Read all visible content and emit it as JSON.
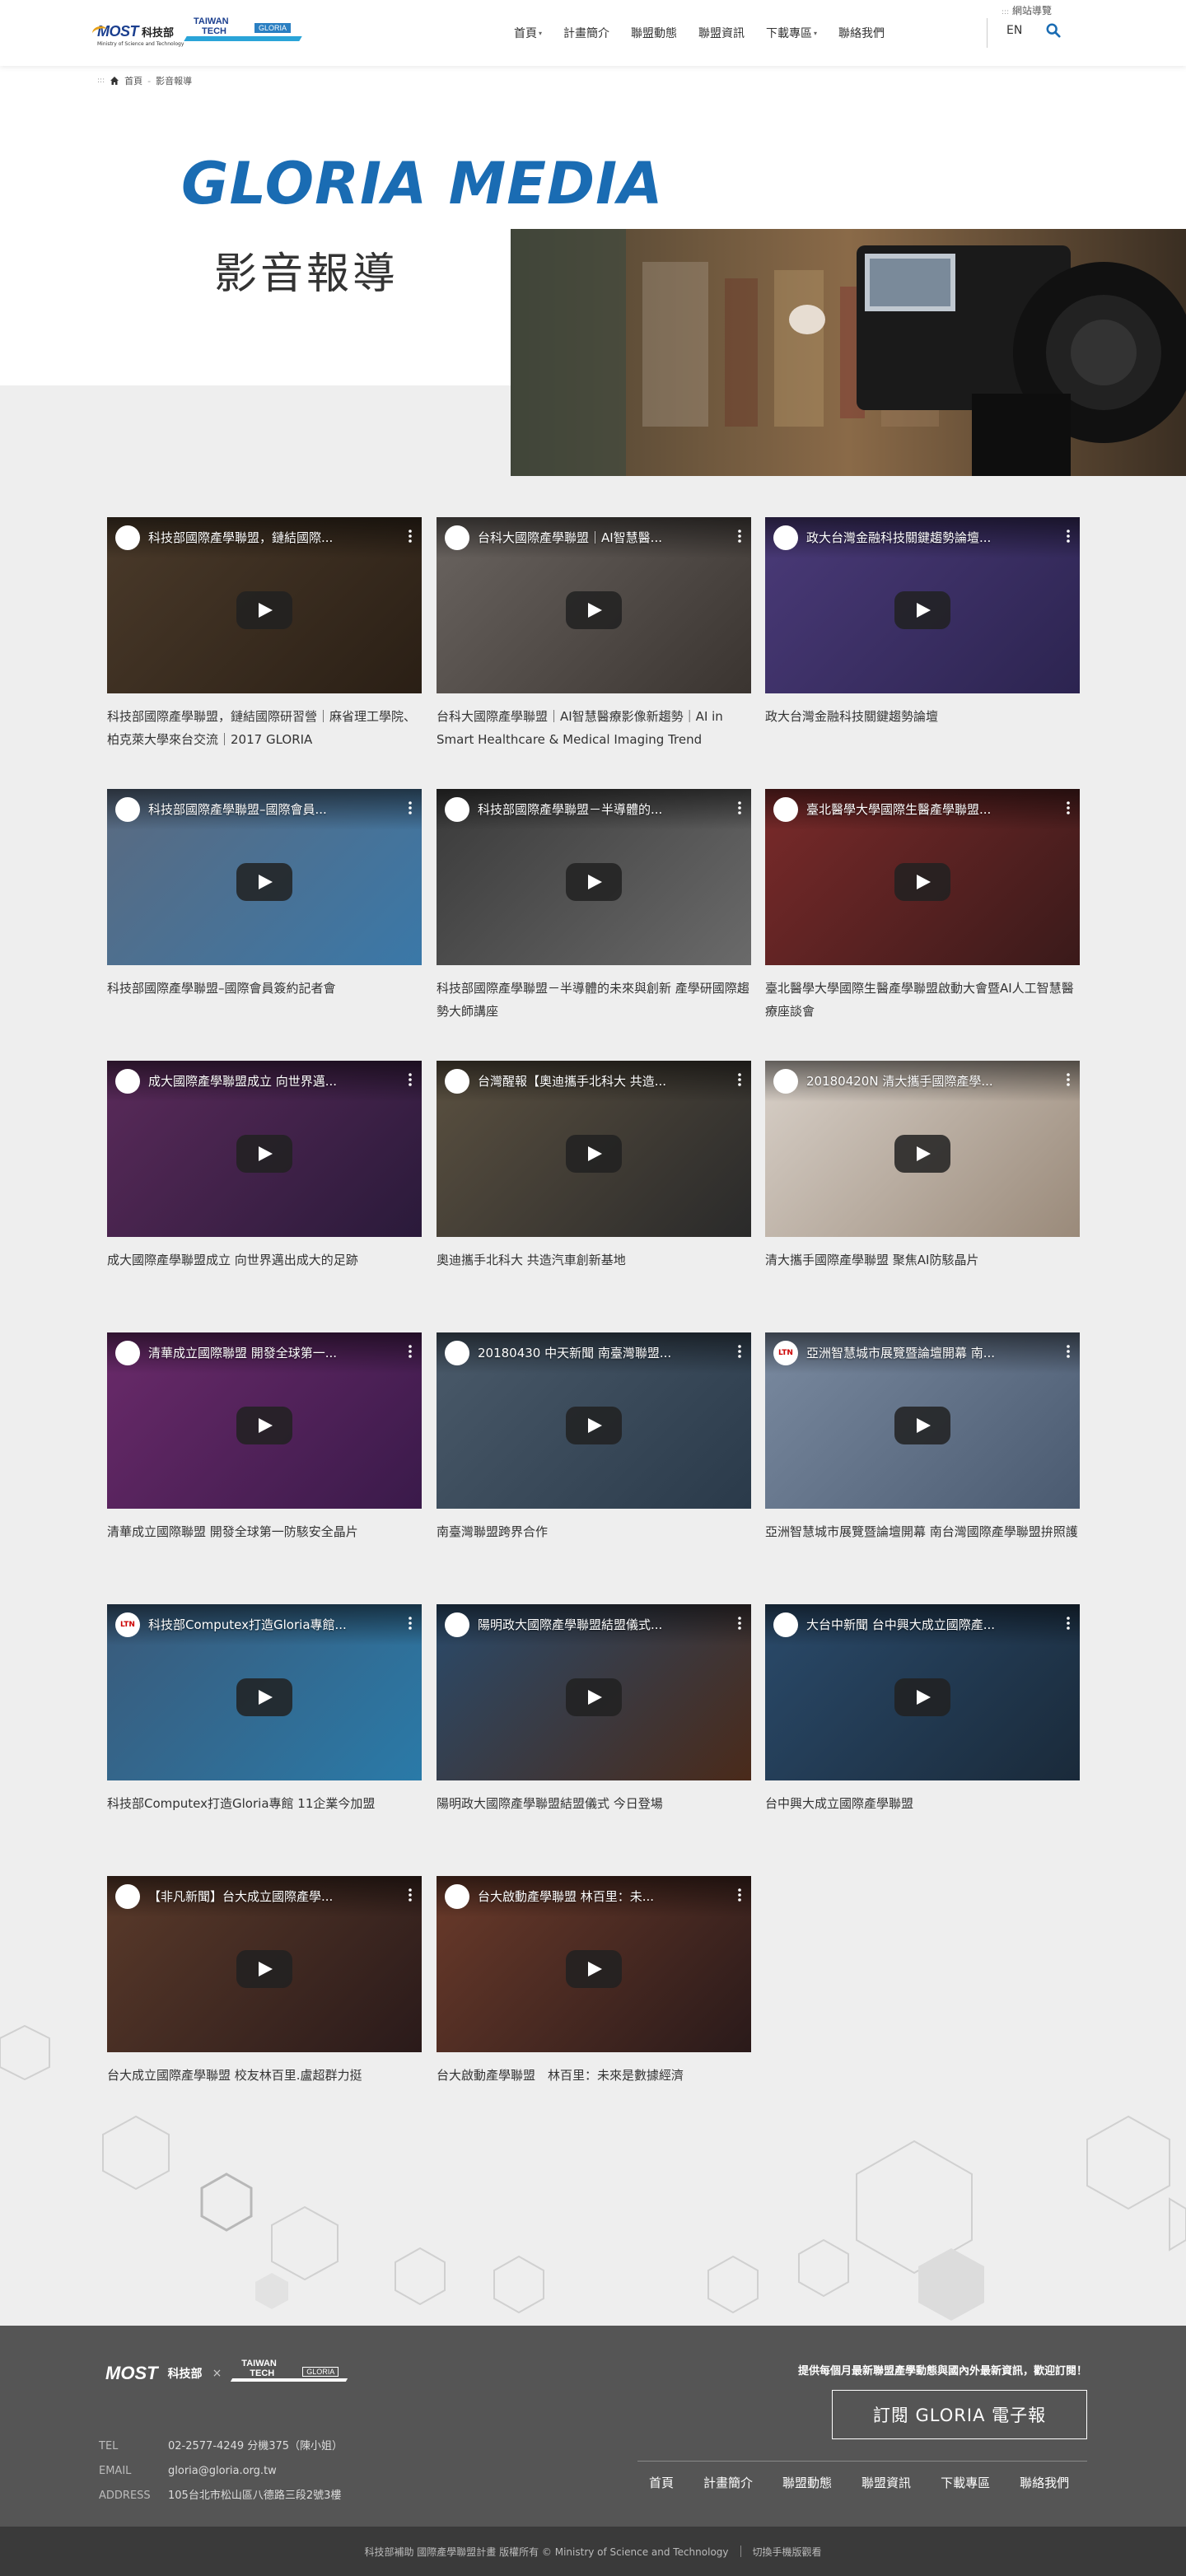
{
  "header": {
    "most_mark": "MOST",
    "most_cn": "科技部",
    "most_sub": "Ministry of Science and Technology",
    "tt_line1": "TAIWAN",
    "tt_line2": "TECH",
    "tt_gloria": "GLORIA",
    "nav": [
      {
        "label": "首頁",
        "has_caret": true
      },
      {
        "label": "計畫簡介",
        "has_caret": false
      },
      {
        "label": "聯盟動態",
        "has_caret": false
      },
      {
        "label": "聯盟資訊",
        "has_caret": false
      },
      {
        "label": "下載專區",
        "has_caret": true
      },
      {
        "label": "聯絡我們",
        "has_caret": false
      }
    ],
    "sitemap": "網站導覽",
    "lang": "EN",
    "search_icon": "search-icon"
  },
  "breadcrumb": {
    "home": "首頁",
    "current": "影音報導"
  },
  "hero": {
    "title": "GLORIA MEDIA",
    "subtitle": "影音報導"
  },
  "videos": [
    {
      "title": "科技部國際產學聯盟，鏈結國際...",
      "caption": "科技部國際產學聯盟，鏈結國際研習營｜麻省理工學院、柏克萊大學來台交流｜2017 GLORIA",
      "avatar": "",
      "colors": [
        "#4a3a2a",
        "#2a1f15"
      ]
    },
    {
      "title": "台科大國際產學聯盟｜AI智慧醫...",
      "caption": "台科大國際產學聯盟｜AI智慧醫療影像新趨勢｜AI in Smart Healthcare & Medical Imaging Trend",
      "avatar": "",
      "colors": [
        "#6a6460",
        "#3a3430"
      ]
    },
    {
      "title": "政大台灣金融科技關鍵趨勢論壇...",
      "caption": "政大台灣金融科技關鍵趨勢論壇",
      "avatar": "",
      "colors": [
        "#4a3a78",
        "#2c2450"
      ]
    },
    {
      "title": "科技部國際產學聯盟–國際會員...",
      "caption": "科技部國際產學聯盟–國際會員簽約記者會",
      "avatar": "",
      "colors": [
        "#5a6a80",
        "#3a78a8"
      ]
    },
    {
      "title": "科技部國際產學聯盟－半導體的...",
      "caption": "科技部國際產學聯盟－半導體的未來與創新 產學研國際趨勢大師講座",
      "avatar": "",
      "colors": [
        "#3a3a3a",
        "#6a6a6a"
      ]
    },
    {
      "title": "臺北醫學大學國際生醫產學聯盟...",
      "caption": "臺北醫學大學國際生醫產學聯盟啟動大會暨AI人工智慧醫療座談會",
      "avatar": "",
      "colors": [
        "#7a2a2a",
        "#3a1a1a"
      ]
    },
    {
      "title": "成大國際產學聯盟成立 向世界邁...",
      "caption": "成大國際產學聯盟成立 向世界邁出成大的足跡",
      "avatar": "",
      "colors": [
        "#5a2a5a",
        "#2a1a3a"
      ]
    },
    {
      "title": "台灣醒報【奧迪攜手北科大 共造...",
      "caption": "奧迪攜手北科大 共造汽車創新基地",
      "avatar": "",
      "colors": [
        "#5a5040",
        "#2a2a2a"
      ]
    },
    {
      "title": "20180420N 清大攜手國際產學...",
      "caption": "清大攜手國際產學聯盟 聚焦AI防駭晶片",
      "avatar": "",
      "colors": [
        "#d8d0c8",
        "#9a8a7a"
      ]
    },
    {
      "title": "清華成立國際聯盟 開發全球第一...",
      "caption": "清華成立國際聯盟 開發全球第一防駭安全晶片",
      "avatar": "",
      "colors": [
        "#6a2a6a",
        "#3a1a4a"
      ]
    },
    {
      "title": "20180430 中天新聞 南臺灣聯盟...",
      "caption": "南臺灣聯盟跨界合作",
      "avatar": "",
      "colors": [
        "#4a5a6a",
        "#2a3a4a"
      ]
    },
    {
      "title": "亞洲智慧城市展覽暨論壇開幕 南...",
      "caption": "亞洲智慧城市展覽暨論壇開幕 南台灣國際產學聯盟拚照護",
      "avatar": "LTN",
      "colors": [
        "#7a8aa0",
        "#4a5a70"
      ]
    },
    {
      "title": "科技部Computex打造Gloria專館...",
      "caption": "科技部Computex打造Gloria專館 11企業今加盟",
      "avatar": "LTN",
      "colors": [
        "#3a5a7a",
        "#2a7aa8"
      ]
    },
    {
      "title": "陽明政大國際產學聯盟結盟儀式...",
      "caption": "陽明政大國際產學聯盟結盟儀式 今日登場",
      "avatar": "",
      "colors": [
        "#2a4a6a",
        "#4a2a1a"
      ]
    },
    {
      "title": "大台中新聞 台中興大成立國際產...",
      "caption": "台中興大成立國際產學聯盟",
      "avatar": "",
      "colors": [
        "#2a4a6a",
        "#1a2a3a"
      ]
    },
    {
      "title": "【非凡新聞】台大成立國際產學...",
      "caption": "台大成立國際產學聯盟 校友林百里.盧超群力挺",
      "avatar": "",
      "colors": [
        "#5a3a2a",
        "#2a1a1a"
      ]
    },
    {
      "title": "台大啟動產學聯盟 林百里：未...",
      "caption": "台大啟動產學聯盟　林百里：未來是數據經濟",
      "avatar": "",
      "colors": [
        "#6a3a2a",
        "#2a1a1a"
      ]
    }
  ],
  "footer": {
    "subscribe_note": "提供每個月最新聯盟產學動態與國內外最新資訊，歡迎訂閱！",
    "subscribe_button": "訂閱 GLORIA 電子報",
    "tel_label": "TEL",
    "tel": "02-2577-4249 分機375（陳小姐）",
    "email_label": "EMAIL",
    "email": "gloria@gloria.org.tw",
    "address_label": "ADDRESS",
    "address": "105台北市松山區八德路三段2號3樓",
    "nav": [
      "首頁",
      "計畫簡介",
      "聯盟動態",
      "聯盟資訊",
      "下載專區",
      "聯絡我們"
    ],
    "copyright": "科技部補助 國際產學聯盟計畫 版權所有 © Ministry of Science and Technology",
    "mobile_link": "切換手機版觀看"
  }
}
